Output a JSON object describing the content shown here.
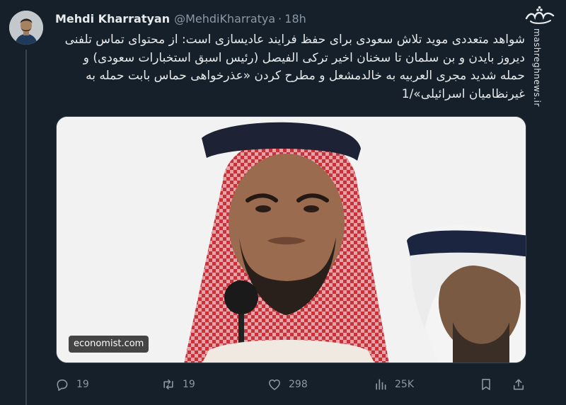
{
  "tweet": {
    "author_name": "Mehdi Kharratyan",
    "author_handle": "@MehdiKharratya",
    "separator": "·",
    "time": "18h",
    "text": "شواهد متعددی موید تلاش سعودی برای حفظ فرایند عادیسازی است: از محتوای تماس تلفنی دیروز بایدن و بن سلمان تا سخنان اخیر ترکی الفیصل (رئیس اسبق استخبارات سعودی) و حمله شدید مجری العربیه به خالدمشعل و مطرح کردن «عذرخواهی حماس بابت حمله به غیرنظامیان اسرائیلی»/1",
    "media_source": "economist.com"
  },
  "watermark": {
    "logo": "مشرق",
    "url": "mashreghnews.ir"
  },
  "actions": {
    "replies": "19",
    "retweets": "19",
    "likes": "298",
    "views": "25K"
  },
  "icons": [
    "reply-icon",
    "retweet-icon",
    "like-icon",
    "views-icon",
    "bookmark-icon",
    "share-icon"
  ],
  "colors": {
    "background": "#15202b",
    "text": "#e7e9ea",
    "secondary": "#8b98a5",
    "divider": "#38444d"
  }
}
